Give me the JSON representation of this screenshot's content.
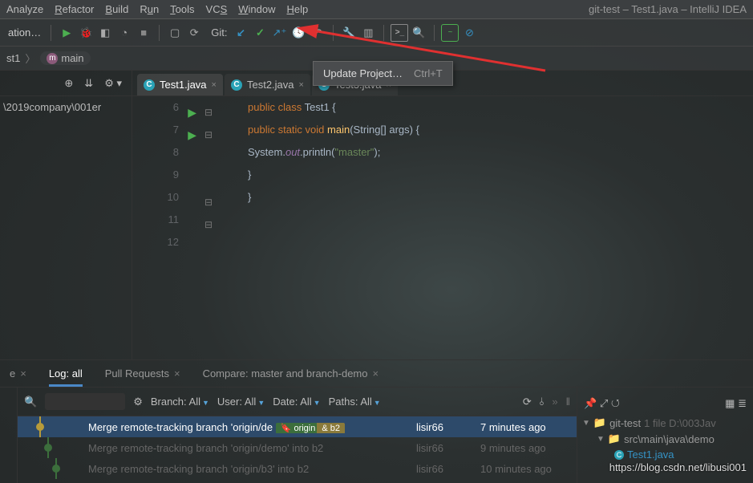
{
  "window": {
    "title": "git-test – Test1.java – IntelliJ IDEA"
  },
  "menu": {
    "analyze": "Analyze",
    "refactor": "Refactor",
    "build": "Build",
    "run": "Run",
    "tools": "Tools",
    "vcs": "VCS",
    "window": "Window",
    "help": "Help"
  },
  "toolbar": {
    "config_label": "ation…",
    "git_label": "Git:",
    "icons": {
      "run": "run-icon",
      "debug": "debug-icon",
      "coverage": "coverage-icon",
      "stop": "stop-icon",
      "update": "vcs-update-icon",
      "commit": "vcs-commit-icon",
      "push": "vcs-push-icon",
      "history": "vcs-history-icon",
      "rollback": "vcs-rollback-icon",
      "settings": "settings-icon",
      "proj_struct": "project-structure-icon",
      "terminal": "terminal-icon",
      "search": "search-everywhere-icon",
      "avatar": "profile-icon",
      "ide": "ide-update-icon"
    }
  },
  "tooltip": {
    "text": "Update Project…",
    "shortcut": "Ctrl+T"
  },
  "nav": {
    "crumb_project": "st1",
    "method": "main",
    "method_badge": "m"
  },
  "project_tree": {
    "path": "\\2019company\\001er"
  },
  "tabs": [
    {
      "label": "Test1.java",
      "active": true
    },
    {
      "label": "Test2.java",
      "active": false
    },
    {
      "label": "Test3.java",
      "active": false
    }
  ],
  "code": {
    "lines": [
      {
        "n": 6,
        "run": true,
        "html": "<span class='kw'>public</span> <span class='kw'>class</span> <span class='cls'>Test1</span> {"
      },
      {
        "n": 7,
        "run": true,
        "html": "    <span class='kw'>public static</span> <span class='kw'>void</span> <span class='fn'>main</span>(String[] args) {"
      },
      {
        "n": 8,
        "html": "        System.<span class='field'>out</span>.println(<span class='str'>\"master\"</span>);"
      },
      {
        "n": 9,
        "html": "        "
      },
      {
        "n": 10,
        "html": "    }"
      },
      {
        "n": 11,
        "html": "}"
      },
      {
        "n": 12,
        "html": ""
      }
    ]
  },
  "bottom_tabs": {
    "unknown": "e",
    "log": "Log: all",
    "pull_requests": "Pull Requests",
    "compare": "Compare: master and branch-demo"
  },
  "vcs": {
    "search_placeholder": "",
    "filters": {
      "branch": "Branch: All",
      "user": "User: All",
      "date": "Date: All",
      "paths": "Paths: All"
    },
    "commits": [
      {
        "msg": "Merge remote-tracking branch 'origin/de",
        "tag1": "origin",
        "tag2": "& b2",
        "author": "lisir66",
        "time": "7 minutes ago",
        "sel": true,
        "color": "#b79b3a"
      },
      {
        "msg": "Merge remote-tracking branch 'origin/demo' into b2",
        "author": "lisir66",
        "time": "9 minutes ago",
        "sel": false,
        "color": "#3c6e3c"
      },
      {
        "msg": "Merge remote-tracking branch 'origin/b3' into b2",
        "author": "lisir66",
        "time": "10 minutes ago",
        "sel": false,
        "color": "#3c6e3c"
      }
    ],
    "tree": {
      "root": "git-test",
      "root_tail": "1 file  D:\\003Jav",
      "sub": "src\\main\\java\\demo",
      "file": "Test1.java"
    }
  },
  "watermark": "https://blog.csdn.net/libusi001"
}
